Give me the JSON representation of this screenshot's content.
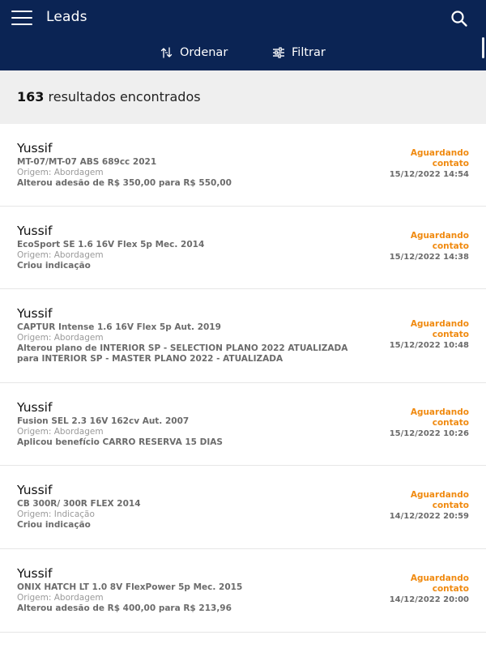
{
  "header": {
    "title": "Leads",
    "menu_icon": "hamburger-menu-icon",
    "search_icon": "search-icon",
    "sort_label": "Ordenar",
    "filter_label": "Filtrar",
    "background": "#0b2454"
  },
  "results": {
    "count": "163",
    "label": "resultados encontrados"
  },
  "colors": {
    "status": "#f08a10",
    "muted": "#9a9a9a",
    "text": "#6b6b6b"
  },
  "leads": [
    {
      "name": "Yussif",
      "vehicle": "MT-07/MT-07 ABS 689cc 2021",
      "origin": "Origem: Abordagem",
      "action": "Alterou adesão de R$ 350,00 para R$ 550,00",
      "status": "Aguardando contato",
      "date": "15/12/2022 14:54"
    },
    {
      "name": "Yussif",
      "vehicle": "EcoSport SE 1.6 16V Flex 5p Mec. 2014",
      "origin": "Origem: Abordagem",
      "action": "Criou indicação",
      "status": "Aguardando contato",
      "date": "15/12/2022 14:38"
    },
    {
      "name": "Yussif",
      "vehicle": "CAPTUR Intense 1.6 16V Flex 5p Aut. 2019",
      "origin": "Origem: Abordagem",
      "action": "Alterou plano de INTERIOR SP - SELECTION PLANO 2022 ATUALIZADA para INTERIOR SP - MASTER PLANO 2022 - ATUALIZADA",
      "status": "Aguardando contato",
      "date": "15/12/2022 10:48"
    },
    {
      "name": "Yussif",
      "vehicle": "Fusion SEL 2.3 16V 162cv Aut. 2007",
      "origin": "Origem: Abordagem",
      "action": "Aplicou benefício CARRO RESERVA 15 DIAS",
      "status": "Aguardando contato",
      "date": "15/12/2022 10:26"
    },
    {
      "name": "Yussif",
      "vehicle": "CB 300R/ 300R FLEX 2014",
      "origin": "Origem: Indicação",
      "action": "Criou indicação",
      "status": "Aguardando contato",
      "date": "14/12/2022 20:59"
    },
    {
      "name": "Yussif",
      "vehicle": "ONIX HATCH LT 1.0 8V FlexPower 5p Mec. 2015",
      "origin": "Origem: Abordagem",
      "action": "Alterou adesão de R$ 400,00 para R$ 213,96",
      "status": "Aguardando contato",
      "date": "14/12/2022 20:00"
    }
  ]
}
